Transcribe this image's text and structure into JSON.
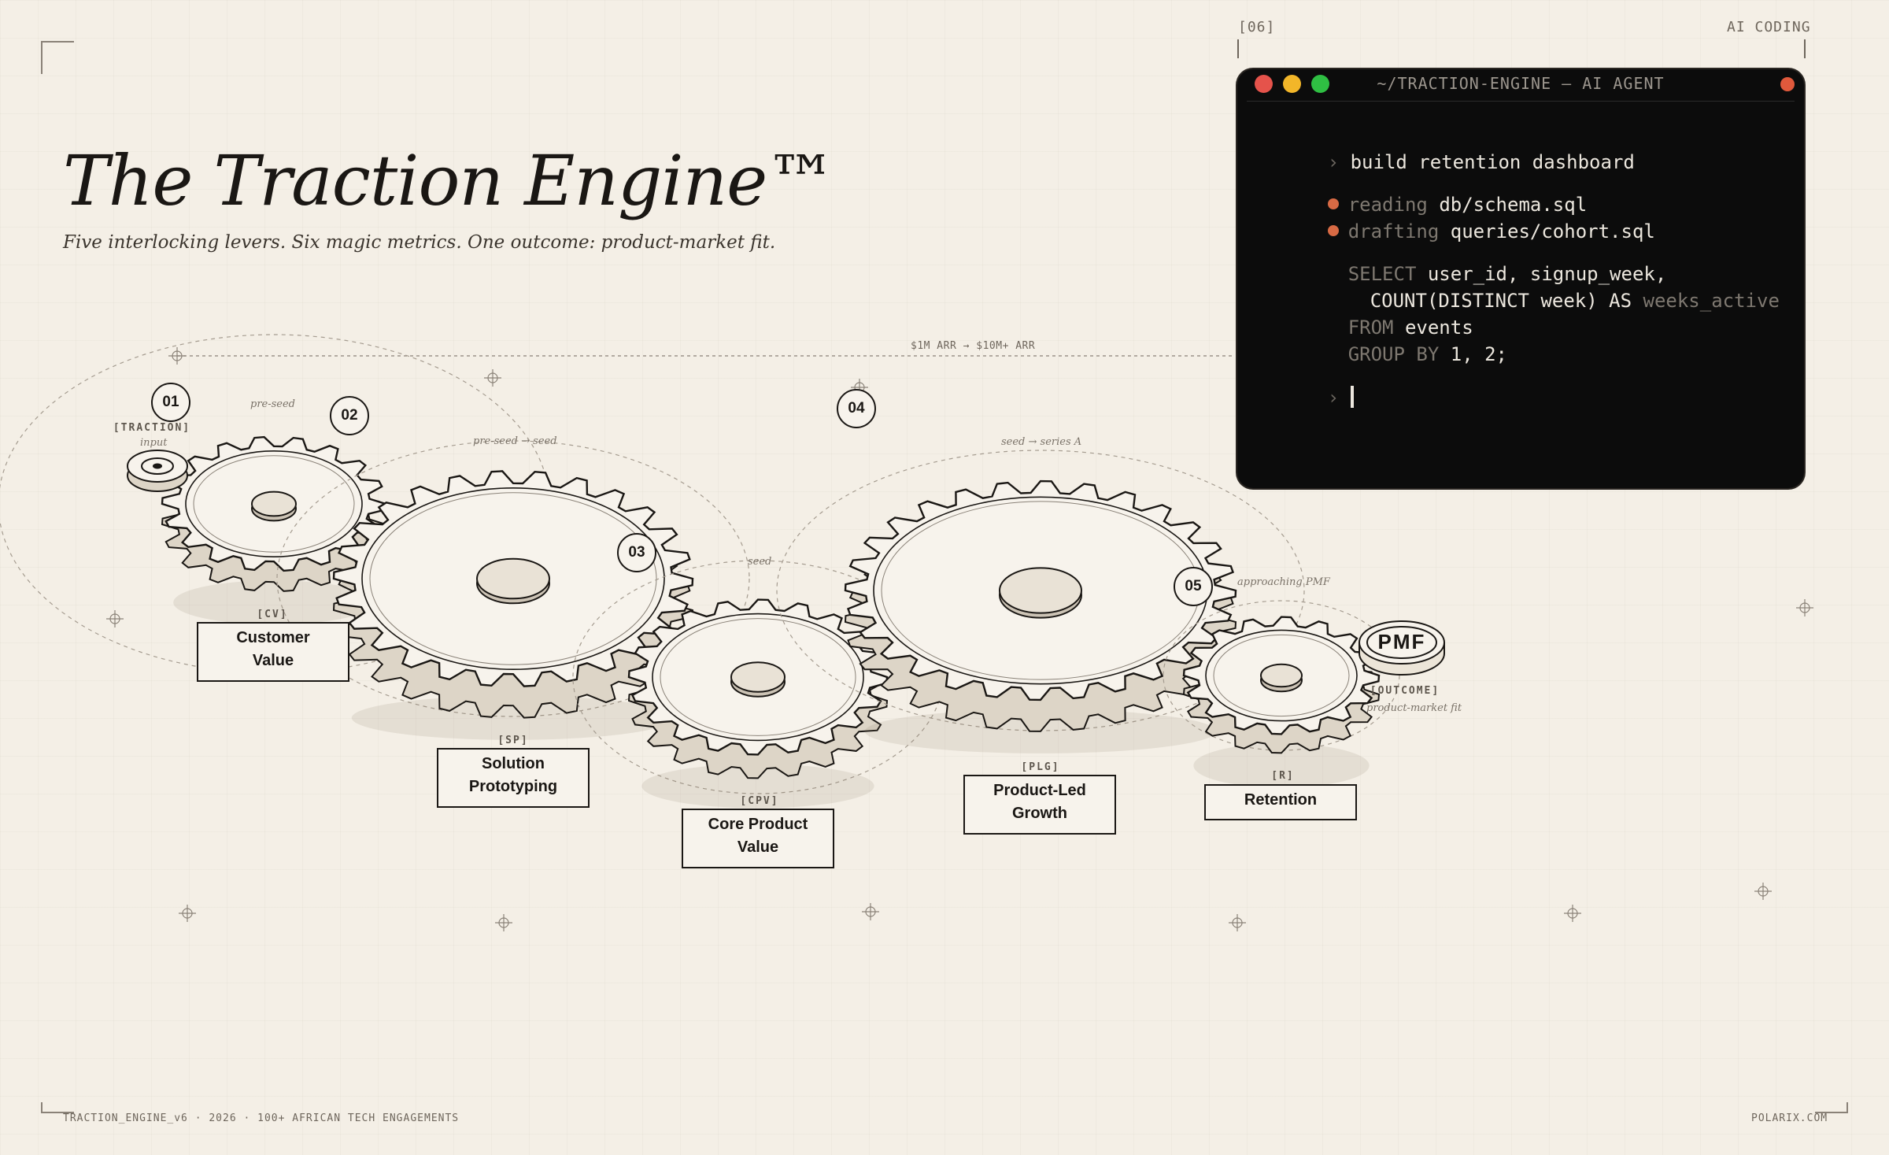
{
  "header": {
    "slide_number": "[06]",
    "section": "AI CODING",
    "title": "The Traction Engine™",
    "subtitle": "Five interlocking levers. Six magic metrics. One outcome: product-market fit."
  },
  "terminal": {
    "title": "~/TRACTION-ENGINE — AI AGENT",
    "command": "build retention dashboard",
    "steps": [
      {
        "verb": "reading",
        "target": "db/schema.sql"
      },
      {
        "verb": "drafting",
        "target": "queries/cohort.sql"
      }
    ],
    "sql": {
      "kw_select": "SELECT",
      "select_cols": "user_id, signup_week,",
      "count_expr": "COUNT(DISTINCT week) AS",
      "alias": "weeks_active",
      "kw_from": "FROM",
      "table": "events",
      "kw_group": "GROUP BY",
      "group_cols": "1, 2;"
    },
    "prompt_glyph": "›"
  },
  "diagram": {
    "arr_range": "$1M ARR → $10M+ ARR",
    "traction_tag": "[TRACTION]",
    "input_note": "input",
    "outcome_tag": "[OUTCOME]",
    "outcome_note": "product-market fit",
    "outcome_label": "PMF",
    "stage_notes": {
      "pre_seed": "pre-seed",
      "pre_seed_to_seed": "pre-seed → seed",
      "seed": "seed",
      "seed_to_series_a": "seed → series A",
      "approaching_pmf": "approaching PMF"
    },
    "badges": [
      "01",
      "02",
      "03",
      "04",
      "05"
    ],
    "levers": [
      {
        "code": "[CV]",
        "line1": "Customer",
        "line2": "Value"
      },
      {
        "code": "[SP]",
        "line1": "Solution",
        "line2": "Prototyping"
      },
      {
        "code": "[CPV]",
        "line1": "Core Product",
        "line2": "Value"
      },
      {
        "code": "[PLG]",
        "line1": "Product-Led",
        "line2": "Growth"
      },
      {
        "code": "[R]",
        "line1": "Retention",
        "line2": ""
      }
    ]
  },
  "footer": {
    "left": "TRACTION_ENGINE_v6 · 2026 · 100+ AFRICAN TECH ENGAGEMENTS",
    "right": "POLARIX.COM"
  },
  "colors": {
    "background": "#f4efe6",
    "ink": "#1a1714",
    "terminal_bg": "#0c0c0c",
    "accent": "#d86a44"
  }
}
